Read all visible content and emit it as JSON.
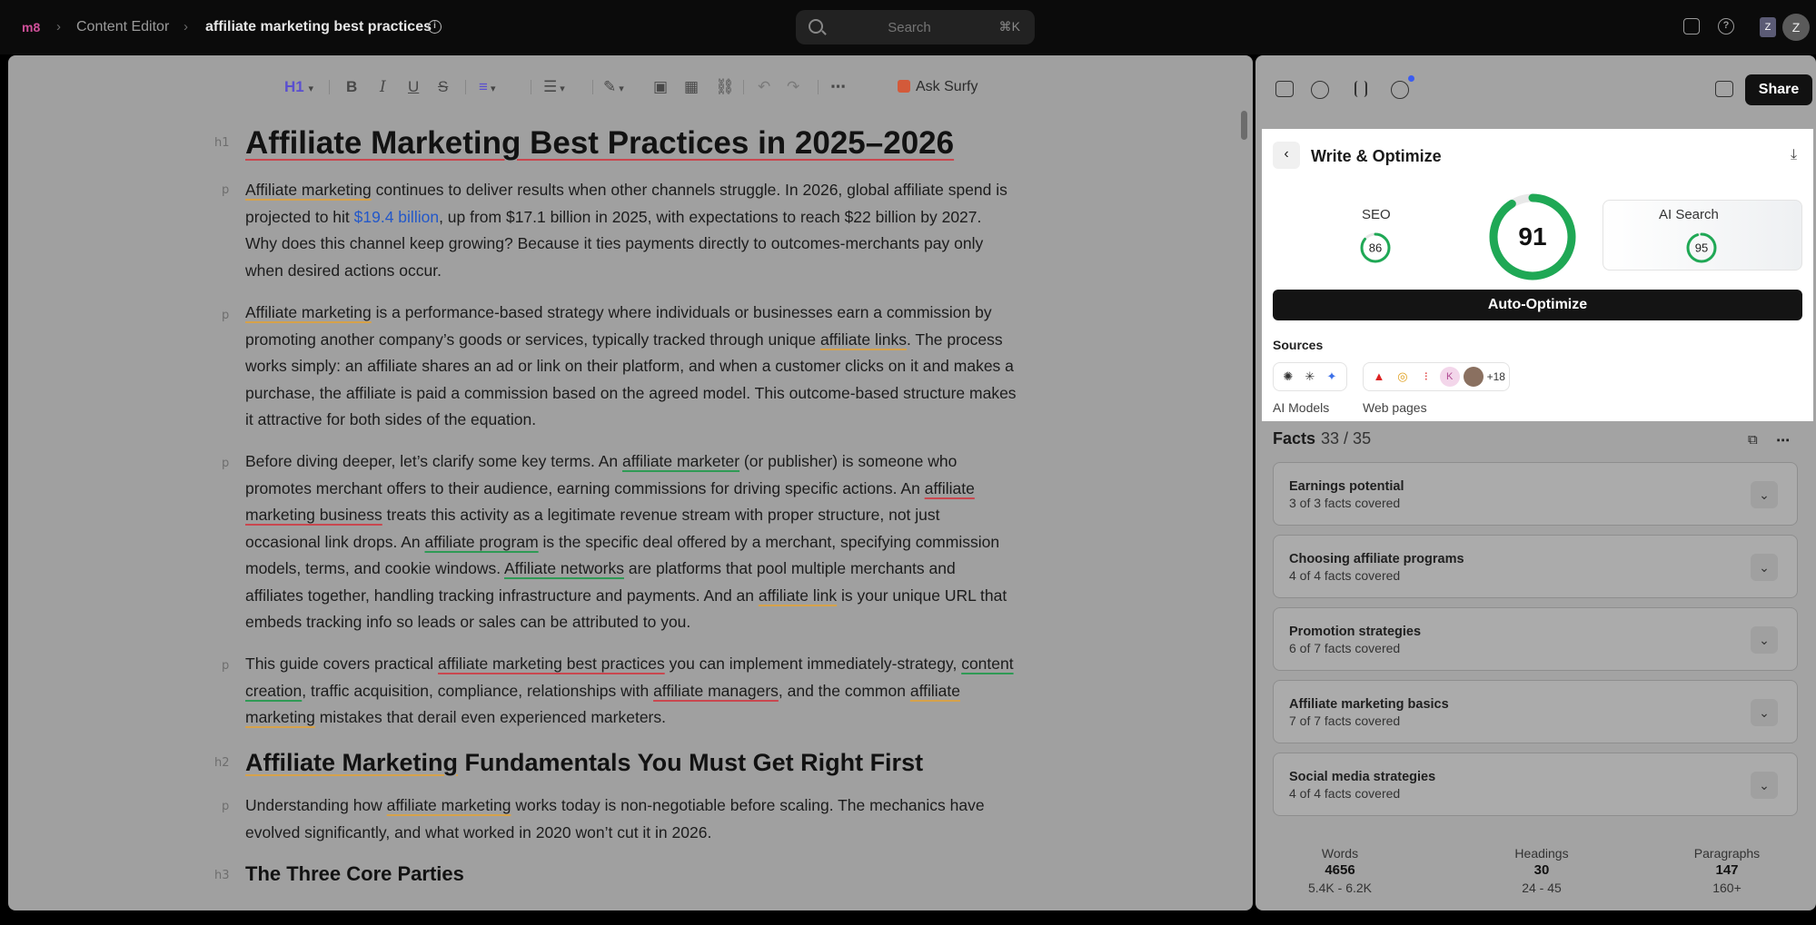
{
  "breadcrumb": {
    "logo": "m8",
    "parent": "Content Editor",
    "current": "affiliate marketing best practices"
  },
  "search": {
    "placeholder": "Search",
    "shortcut": "⌘K"
  },
  "avatars": {
    "small": "Z",
    "large": "Z"
  },
  "toolbar": {
    "heading": "H1",
    "ask": "Ask Surfy"
  },
  "document": {
    "h1": "Affiliate Marketing Best Practices in 2025–2026",
    "tags": {
      "h1": "h1",
      "p": "p",
      "h2": "h2",
      "h3": "h3"
    },
    "p1": {
      "a": "Affiliate marketing",
      "b": " continues to deliver results when other channels struggle. In 2026, global affiliate spend is projected to hit ",
      "link": "$19.4 billion",
      "c": ", up from $17.1 billion in 2025, with expectations to reach $22 billion by 2027. Why does this channel keep growing? Because it ties payments directly to outcomes-merchants pay only when desired actions occur."
    },
    "p2": {
      "a": "Affiliate marketing",
      "b": " is a performance-based strategy where individuals or businesses earn a commission by promoting another company’s goods or services, typically tracked through unique ",
      "c": "affiliate links",
      "d": ". The process works simply: an affiliate shares an ad or link on their platform, and when a customer clicks on it and makes a purchase, the affiliate is paid a commission based on the agreed model. This outcome-based structure makes it attractive for both sides of the equation."
    },
    "p3": {
      "a": "Before diving deeper, let’s clarify some key terms. An ",
      "b": "affiliate marketer",
      "c": " (or publisher) is someone who promotes merchant offers to their audience, earning commissions for driving specific actions. An ",
      "d": "affiliate marketing business",
      "e": " treats this activity as a legitimate revenue stream with proper structure, not just occasional link drops. An ",
      "f": "affiliate program",
      "g": " is the specific deal offered by a merchant, specifying commission models, terms, and cookie windows. ",
      "h": "Affiliate networks",
      "i": " are platforms that pool multiple merchants and affiliates together, handling tracking infrastructure and payments. And an ",
      "j": "affiliate link",
      "k": " is your unique URL that embeds tracking info so leads or sales can be attributed to you."
    },
    "p4": {
      "a": "This guide covers practical ",
      "b": "affiliate marketing best practices",
      "c": " you can implement immediately-strategy, ",
      "d": "content creation",
      "e": ", traffic acquisition, compliance, relationships with ",
      "f": "affiliate managers",
      "g": ", and the common ",
      "h": "affiliate marketing",
      "i": " mistakes that derail even experienced marketers."
    },
    "h2": {
      "a": "Affiliate Marketing",
      "b": " Fundamentals You Must Get Right First"
    },
    "p5": {
      "a": "Understanding how ",
      "b": "affiliate marketing",
      "c": " works today is non-negotiable before scaling. The mechanics have evolved significantly, and what worked in 2020 won’t cut it in 2026."
    },
    "h3": "The Three Core Parties"
  },
  "panel": {
    "share": "Share",
    "title": "Write & Optimize",
    "seo": {
      "label": "SEO",
      "score": "86"
    },
    "overall": {
      "score": "91"
    },
    "ai_search": {
      "label": "AI Search",
      "score": "95"
    },
    "auto_optimize": "Auto-Optimize",
    "sources_title": "Sources",
    "ai_models_label": "AI Models",
    "web_pages_label": "Web pages",
    "web_more": "+18",
    "facts_title": "Facts",
    "facts_count": "33 / 35",
    "facts": [
      {
        "title": "Earnings potential",
        "sub": "3 of 3 facts covered"
      },
      {
        "title": "Choosing affiliate programs",
        "sub": "4 of 4 facts covered"
      },
      {
        "title": "Promotion strategies",
        "sub": "6 of 7 facts covered"
      },
      {
        "title": "Affiliate marketing basics",
        "sub": "7 of 7 facts covered"
      },
      {
        "title": "Social media strategies",
        "sub": "4 of 4 facts covered"
      }
    ],
    "stats": {
      "words": {
        "label": "Words",
        "value": "4656",
        "range": "5.4K - 6.2K"
      },
      "headings": {
        "label": "Headings",
        "value": "30",
        "range": "24 - 45"
      },
      "paragraphs": {
        "label": "Paragraphs",
        "value": "147",
        "range": "160+"
      }
    }
  },
  "colors": {
    "ring": "#1fa855",
    "accent": "#5a4fd0",
    "link": "#2358c9"
  }
}
